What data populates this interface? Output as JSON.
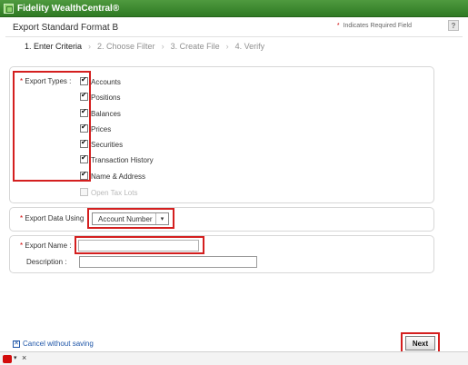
{
  "app": {
    "title": "Fidelity WealthCentral®"
  },
  "header": {
    "title": "Export Standard Format B",
    "required_note": "Indicates Required Field",
    "required_star": "*",
    "help_label": "?"
  },
  "steps": [
    "1. Enter Criteria",
    "2. Choose Filter",
    "3. Create File",
    "4. Verify"
  ],
  "export_types": {
    "label": "Export Types :",
    "star": "*",
    "items": [
      {
        "label": "Accounts",
        "checked": true
      },
      {
        "label": "Positions",
        "checked": true
      },
      {
        "label": "Balances",
        "checked": true
      },
      {
        "label": "Prices",
        "checked": true
      },
      {
        "label": "Securities",
        "checked": true
      },
      {
        "label": "Transaction History",
        "checked": true
      },
      {
        "label": "Name & Address",
        "checked": true
      },
      {
        "label": "Open Tax Lots",
        "checked": false,
        "disabled": true
      }
    ]
  },
  "export_data_using": {
    "label": "Export Data Using",
    "star": "*",
    "selected": "Account Number",
    "arrow_icon": "dropdown-arrow-icon"
  },
  "export_name": {
    "label": "Export Name :",
    "star": "*",
    "value": ""
  },
  "description": {
    "label": "Description :",
    "value": ""
  },
  "footer": {
    "cancel_label": "Cancel without saving",
    "next_label": "Next"
  },
  "colors": {
    "brand_green": "#2f7a24",
    "highlight_red": "#d41f1f",
    "link_blue": "#1f56a8"
  }
}
